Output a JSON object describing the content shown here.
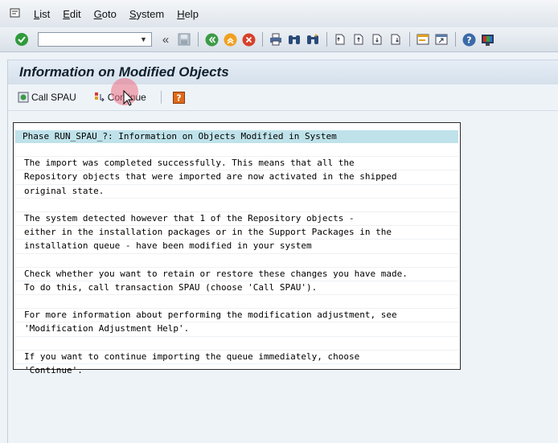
{
  "menu": {
    "items": [
      {
        "u": "L",
        "rest": "ist"
      },
      {
        "u": "E",
        "rest": "dit"
      },
      {
        "u": "G",
        "rest": "oto"
      },
      {
        "u": "S",
        "rest": "ystem"
      },
      {
        "u": "H",
        "rest": "elp"
      }
    ]
  },
  "toolbar": {
    "command_value": "",
    "back_glyph": "«"
  },
  "page": {
    "title": "Information on Modified Objects"
  },
  "apptoolbar": {
    "call_spau_label": "Call SPAU",
    "continue_label": "Continue"
  },
  "info": {
    "header": "Phase RUN_SPAU_?: Information on Objects Modified in System",
    "lines": [
      "",
      "The import was completed successfully. This means that all the",
      "Repository objects that were imported are now activated in the shipped",
      "original state.",
      "",
      "The system detected however that 1 of the Repository objects -",
      "either in the installation packages or in the Support Packages in the",
      "installation queue - have been modified in your system",
      "",
      "Check whether you want to retain or restore these changes you have made.",
      "To do this, call transaction SPAU (choose 'Call SPAU').",
      "",
      "For more information about performing the modification adjustment, see",
      "'Modification Adjustment Help'.",
      "",
      "If you want to continue importing the queue immediately, choose",
      "'Continue'."
    ]
  },
  "colors": {
    "header_highlight": "#bfe2ea",
    "enter_green": "#2e9a3a",
    "help_orange": "#e06a1a"
  }
}
